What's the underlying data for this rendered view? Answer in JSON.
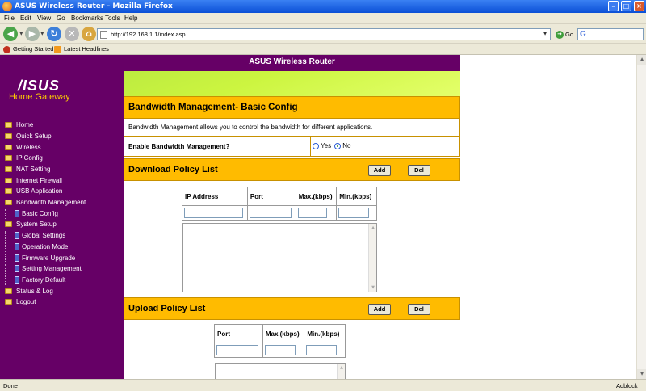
{
  "window": {
    "title": "ASUS Wireless Router - Mozilla Firefox"
  },
  "menu": [
    "File",
    "Edit",
    "View",
    "Go",
    "Bookmarks",
    "Tools",
    "Help"
  ],
  "toolbar": {
    "url": "http://192.168.1.1/index.asp",
    "go_label": "Go",
    "search_icon": "G"
  },
  "bookmarks": [
    "Getting Started",
    "Latest Headlines"
  ],
  "header": {
    "title": "ASUS Wireless Router"
  },
  "sidebar": {
    "logo": "/ISUS",
    "subtitle": "Home Gateway",
    "items": [
      {
        "label": "Home",
        "kind": "folder"
      },
      {
        "label": "Quick Setup",
        "kind": "folder"
      },
      {
        "label": "Wireless",
        "kind": "folder"
      },
      {
        "label": "IP Config",
        "kind": "folder"
      },
      {
        "label": "NAT Setting",
        "kind": "folder"
      },
      {
        "label": "Internet Firewall",
        "kind": "folder"
      },
      {
        "label": "USB Application",
        "kind": "folder"
      },
      {
        "label": "Bandwidth Management",
        "kind": "folder"
      },
      {
        "label": "Basic Config",
        "kind": "doc"
      },
      {
        "label": "System Setup",
        "kind": "folder"
      },
      {
        "label": "Global Settings",
        "kind": "doc"
      },
      {
        "label": "Operation Mode",
        "kind": "doc"
      },
      {
        "label": "Firmware Upgrade",
        "kind": "doc"
      },
      {
        "label": "Setting Management",
        "kind": "doc"
      },
      {
        "label": "Factory Default",
        "kind": "doc"
      },
      {
        "label": "Status & Log",
        "kind": "folder"
      },
      {
        "label": "Logout",
        "kind": "folder"
      }
    ]
  },
  "main": {
    "heading": "Bandwidth Management- Basic Config",
    "description": "Bandwidth Management allows you to control the bandwidth for different applications.",
    "enable_label": "Enable Bandwidth Management?",
    "enable_options": [
      "Yes",
      "No"
    ],
    "enable_selected": "No",
    "download": {
      "title": "Download Policy List",
      "add": "Add",
      "del": "Del",
      "columns": [
        "IP Address",
        "Port",
        "Max.(kbps)",
        "Min.(kbps)"
      ]
    },
    "upload": {
      "title": "Upload Policy List",
      "add": "Add",
      "del": "Del",
      "columns": [
        "Port",
        "Max.(kbps)",
        "Min.(kbps)"
      ]
    }
  },
  "status": {
    "left": "Done",
    "right": "Adblock"
  },
  "colors": {
    "sidebar": "#660066",
    "accent": "#ffbb00",
    "banner": "#ccf540"
  }
}
